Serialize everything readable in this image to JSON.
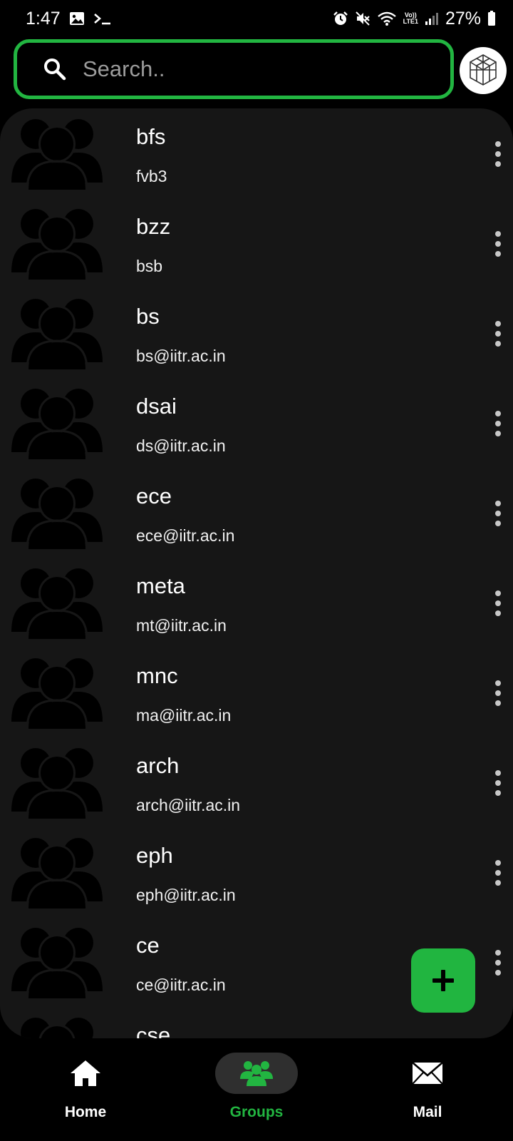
{
  "status_bar": {
    "time": "1:47",
    "volte_label_top": "Vo))",
    "volte_label_bottom": "LTE1",
    "battery_percent": "27%"
  },
  "search": {
    "placeholder": "Search.."
  },
  "groups": [
    {
      "name": "bfs",
      "email": "fvb3"
    },
    {
      "name": "bzz",
      "email": "bsb"
    },
    {
      "name": "bs",
      "email": "bs@iitr.ac.in"
    },
    {
      "name": "dsai",
      "email": "ds@iitr.ac.in"
    },
    {
      "name": "ece",
      "email": "ece@iitr.ac.in"
    },
    {
      "name": "meta",
      "email": "mt@iitr.ac.in"
    },
    {
      "name": "mnc",
      "email": "ma@iitr.ac.in"
    },
    {
      "name": "arch",
      "email": "arch@iitr.ac.in"
    },
    {
      "name": "eph",
      "email": "eph@iitr.ac.in"
    },
    {
      "name": "ce",
      "email": "ce@iitr.ac.in"
    },
    {
      "name": "cse",
      "email": ""
    }
  ],
  "fab": {
    "icon": "plus-icon"
  },
  "bottom_nav": {
    "items": [
      {
        "label": "Home",
        "icon": "home-icon",
        "active": false
      },
      {
        "label": "Groups",
        "icon": "groups-icon",
        "active": true
      },
      {
        "label": "Mail",
        "icon": "mail-icon",
        "active": false
      }
    ]
  },
  "colors": {
    "accent": "#22b541",
    "background": "#000000",
    "panel": "#161616",
    "nav_active_pill": "#2f2f2f"
  }
}
